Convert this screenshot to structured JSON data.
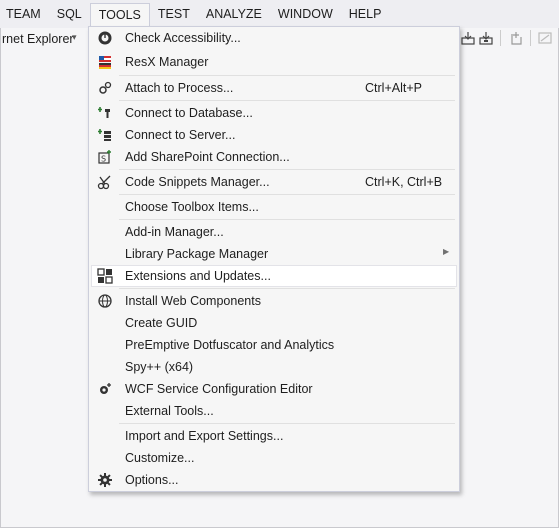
{
  "menubar": {
    "items": [
      {
        "label": "TEAM"
      },
      {
        "label": "SQL"
      },
      {
        "label": "TOOLS",
        "active": true
      },
      {
        "label": "TEST"
      },
      {
        "label": "ANALYZE"
      },
      {
        "label": "WINDOW"
      },
      {
        "label": "HELP"
      }
    ]
  },
  "toolbar": {
    "combo_text": "rnet Explorer",
    "combo_arrow": "▾"
  },
  "tools_menu": {
    "items": [
      {
        "label": "Check Accessibility...",
        "shortcut": "",
        "icon": "accessibility-icon"
      },
      {
        "label": "ResX Manager",
        "shortcut": "",
        "icon": "resx-flag-icon"
      },
      {
        "label": "Attach to Process...",
        "shortcut": "Ctrl+Alt+P",
        "icon": "attach-process-icon"
      },
      {
        "label": "Connect to Database...",
        "shortcut": "",
        "icon": "connect-database-icon"
      },
      {
        "label": "Connect to Server...",
        "shortcut": "",
        "icon": "connect-server-icon"
      },
      {
        "label": "Add SharePoint Connection...",
        "shortcut": "",
        "icon": "sharepoint-icon"
      },
      {
        "label": "Code Snippets Manager...",
        "shortcut": "Ctrl+K, Ctrl+B",
        "icon": "snippets-icon"
      },
      {
        "label": "Choose Toolbox Items...",
        "shortcut": "",
        "icon": ""
      },
      {
        "label": "Add-in Manager...",
        "shortcut": "",
        "icon": ""
      },
      {
        "label": "Library Package Manager",
        "shortcut": "",
        "icon": "",
        "submenu_arrow": "▶"
      },
      {
        "label": "Extensions and Updates...",
        "shortcut": "",
        "icon": "extensions-icon",
        "highlighted": true
      },
      {
        "label": "Install Web Components",
        "shortcut": "",
        "icon": "globe-icon"
      },
      {
        "label": "Create GUID",
        "shortcut": "",
        "icon": ""
      },
      {
        "label": "PreEmptive Dotfuscator and Analytics",
        "shortcut": "",
        "icon": ""
      },
      {
        "label": "Spy++ (x64)",
        "shortcut": "",
        "icon": ""
      },
      {
        "label": "WCF Service Configuration Editor",
        "shortcut": "",
        "icon": "wcf-gear-icon"
      },
      {
        "label": "External Tools...",
        "shortcut": "",
        "icon": ""
      },
      {
        "label": "Import and Export Settings...",
        "shortcut": "",
        "icon": ""
      },
      {
        "label": "Customize...",
        "shortcut": "",
        "icon": ""
      },
      {
        "label": "Options...",
        "shortcut": "",
        "icon": "gear-icon"
      }
    ]
  },
  "colors": {
    "menubar_bg": "#eeeef2",
    "menu_bg": "#f6f6f6",
    "highlight_bg": "#ffffff",
    "border": "#cccedb"
  }
}
